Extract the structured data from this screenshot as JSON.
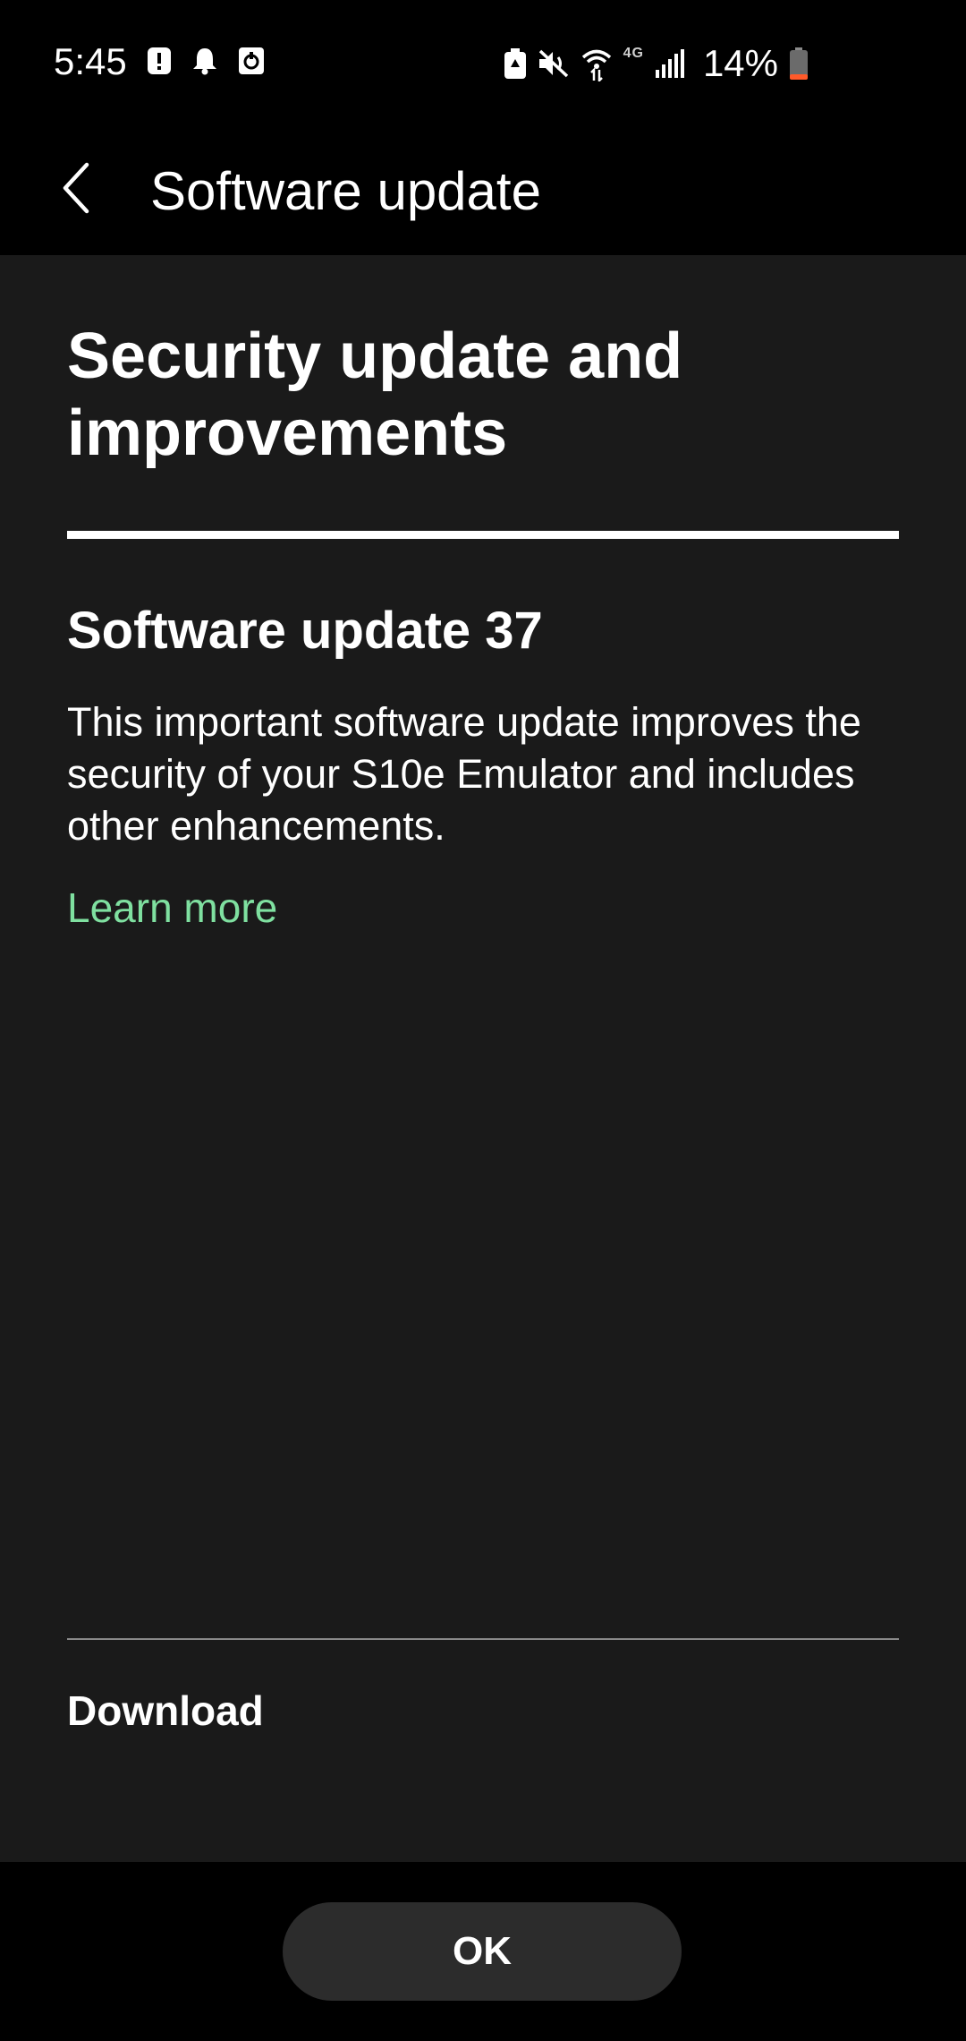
{
  "status_bar": {
    "time": "5:45",
    "network_type": "4G",
    "battery_percent": "14%",
    "battery_level": 0.14,
    "icons": [
      "alert-icon",
      "notification-bell-icon",
      "sync-app-icon",
      "battery-saver-icon",
      "mute-icon",
      "wifi-icon",
      "signal-icon",
      "battery-icon"
    ]
  },
  "app_bar": {
    "title": "Software update",
    "back_icon": "back-chevron-icon"
  },
  "main": {
    "headline": "Security update and improvements",
    "update_title": "Software update 37",
    "update_description": "This important software update improves the security of your S10e Emulator and includes other enhancements.",
    "learn_more_label": "Learn more",
    "download_label": "Download"
  },
  "footer": {
    "ok_label": "OK"
  },
  "colors": {
    "background": "#1a1a1a",
    "bar_background": "#000000",
    "accent_link": "#7fe0a0",
    "battery_low": "#ff5a2a",
    "button_background": "#2c2c2c"
  }
}
